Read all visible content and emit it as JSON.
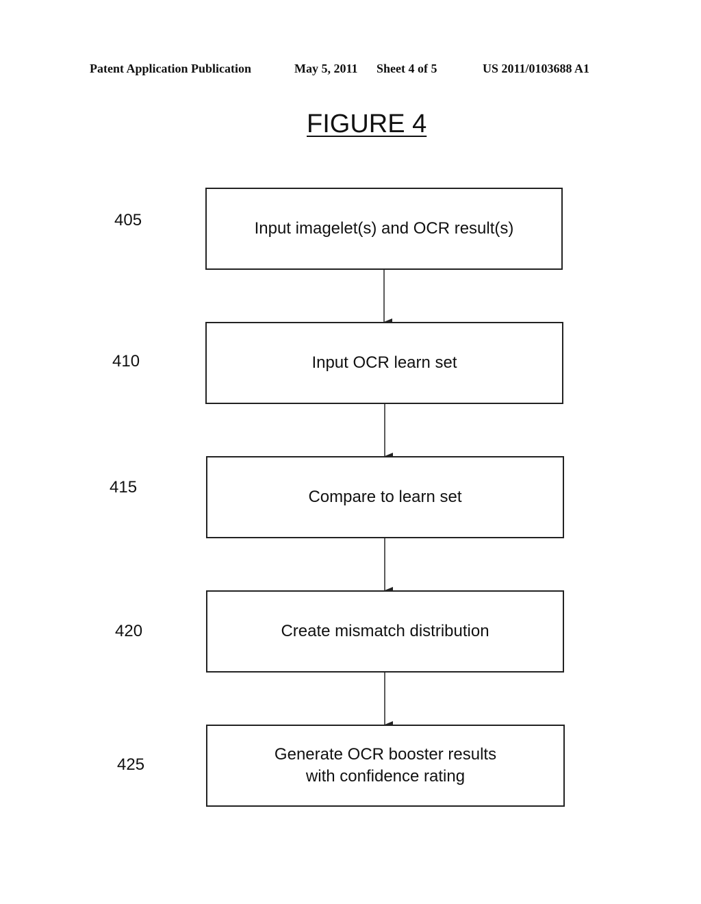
{
  "header": {
    "publication": "Patent Application Publication",
    "date": "May 5, 2011",
    "sheet": "Sheet 4 of 5",
    "number": "US 2011/0103688 A1"
  },
  "figure_title": "FIGURE 4",
  "steps": [
    {
      "ref": "405",
      "label": "Input imagelet(s) and OCR result(s)"
    },
    {
      "ref": "410",
      "label": "Input OCR learn set"
    },
    {
      "ref": "415",
      "label": "Compare to learn set"
    },
    {
      "ref": "420",
      "label": "Create mismatch distribution"
    },
    {
      "ref": "425",
      "label": "Generate OCR booster results with confidence rating"
    }
  ]
}
